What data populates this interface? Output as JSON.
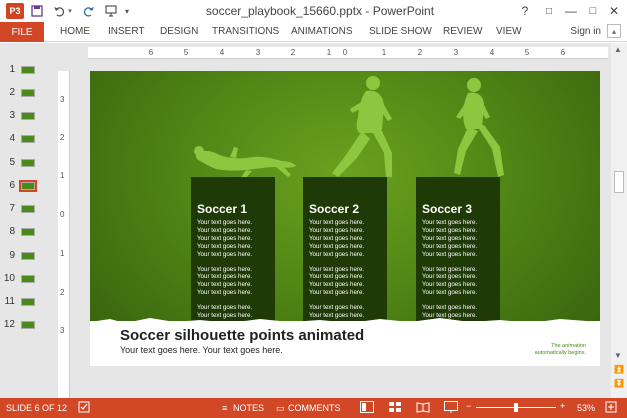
{
  "titlebar": {
    "app_icon": "P3",
    "title": "soccer_playbook_15660.pptx - PowerPoint",
    "help": "?",
    "restore_ribbon": "□",
    "minimize": "—",
    "maximize": "□",
    "close": "✕",
    "save_icon": "save-icon",
    "undo_icon": "undo-icon",
    "redo_icon": "redo-icon",
    "start_from_beginning_icon": "presentation-icon"
  },
  "ribbon": {
    "file": "FILE",
    "tabs": [
      "HOME",
      "INSERT",
      "DESIGN",
      "TRANSITIONS",
      "ANIMATIONS",
      "SLIDE SHOW",
      "REVIEW",
      "VIEW"
    ],
    "signin": "Sign in"
  },
  "thumbnails": [
    "1",
    "2",
    "3",
    "4",
    "5",
    "6",
    "7",
    "8",
    "9",
    "10",
    "11",
    "12"
  ],
  "ruler": {
    "horizontal": [
      "6",
      "5",
      "4",
      "3",
      "2",
      "1",
      "0",
      "1",
      "2",
      "3",
      "4",
      "5",
      "6"
    ],
    "vertical": [
      "3",
      "2",
      "1",
      "0",
      "1",
      "2",
      "3"
    ]
  },
  "slide": {
    "title": "Soccer silhouette points animated",
    "subtitle": "Your text goes here. Your text goes here.",
    "note_line1": "The animation",
    "note_line2": "automatically begins.",
    "columns": [
      {
        "heading": "Soccer 1"
      },
      {
        "heading": "Soccer 2"
      },
      {
        "heading": "Soccer 3"
      }
    ],
    "body_line": "Your text goes here.",
    "colors": {
      "background": "#4f8615",
      "silhouette": "#8dc63f",
      "column": "#1f3a06"
    }
  },
  "status": {
    "slide": "SLIDE 6 OF 12",
    "notes": "NOTES",
    "comments": "COMMENTS",
    "zoom_minus": "−",
    "zoom_plus": "+",
    "zoom": "53%",
    "accent": "#d24726",
    "zoom_level_percent": 53
  }
}
